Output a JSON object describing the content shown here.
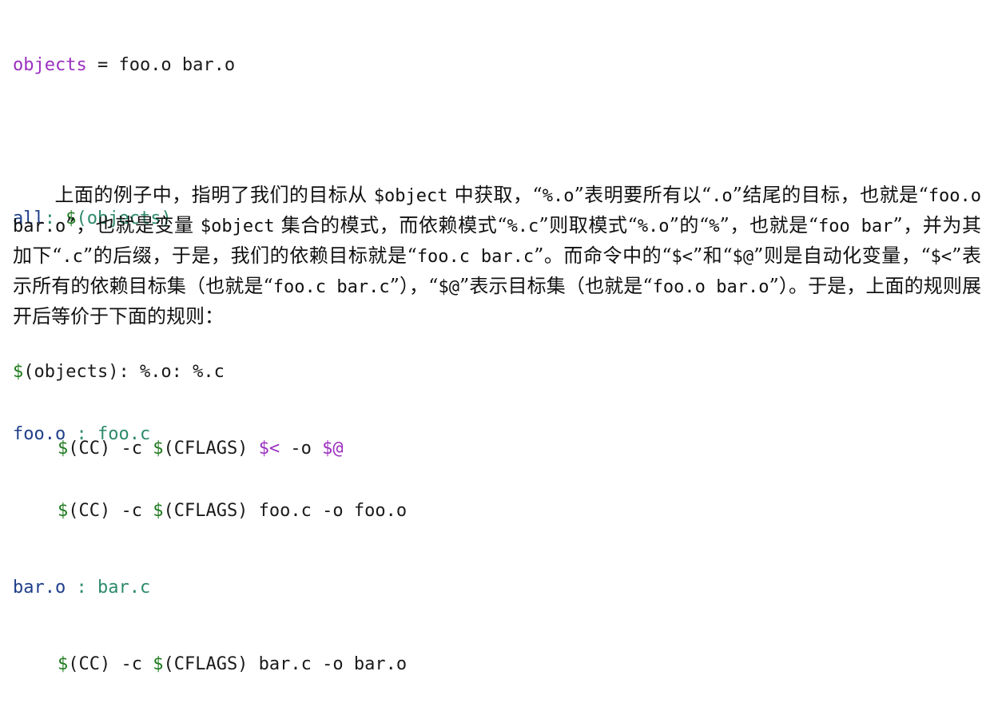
{
  "code1": {
    "line1": {
      "var": "objects",
      "rest": " = foo.o bar.o"
    },
    "line2": {
      "target": "all",
      "colon": ": ",
      "dollar": "$",
      "dep": "(objects)"
    },
    "line3": {
      "dollar": "$",
      "rest": "(objects): %.o: %.c"
    },
    "line4": {
      "d1": "$",
      "cc": "(CC) -c ",
      "d2": "$",
      "cflags": "(CFLAGS) ",
      "auto1": "$<",
      "mid": " -o ",
      "auto2": "$@"
    }
  },
  "paragraph": {
    "s1": "上面的例子中，指明了我们的目标从 ",
    "m1": "$object",
    "s2": " 中获取，“",
    "m2": "%.o",
    "s3": "”表明要所有以“",
    "m3": ".o",
    "s4": "”结尾的目标，也就是“",
    "m4": "foo.o bar.o",
    "s5": "”，也就是变量 ",
    "m5": "$object",
    "s6": " 集合的模式，而依赖模式“",
    "m6": "%.c",
    "s7": "”则取模式“",
    "m7": "%.o",
    "s8": "”的“",
    "m8": "%",
    "s9": "”，也就是“",
    "m9": "foo bar",
    "s10": "”，并为其加下“",
    "m10": ".c",
    "s11": "”的后缀，于是，我们的依赖目标就是“",
    "m11": "foo.c bar.c",
    "s12": "”。而命令中的“",
    "m12": "$<",
    "s13": "”和“",
    "m13": "$@",
    "s14": "”则是自动化变量，“",
    "m14": "$<",
    "s15": "”表示所有的依赖目标集（也就是“",
    "m15": "foo.c bar.c",
    "s16": "”），“",
    "m16": "$@",
    "s17": "”表示目标集（也就是“",
    "m17": "foo.o bar.o",
    "s18": "”）。于是，上面的规则展开后等价于下面的规则："
  },
  "code2": {
    "line1": {
      "target": "foo.o",
      "sep": " : ",
      "dep": "foo.c"
    },
    "line2": {
      "d1": "$",
      "cc": "(CC) -c ",
      "d2": "$",
      "rest": "(CFLAGS) foo.c -o foo.o"
    },
    "line3": {
      "target": "bar.o",
      "sep": " : ",
      "dep": "bar.c"
    },
    "line4": {
      "d1": "$",
      "cc": "(CC) -c ",
      "d2": "$",
      "rest": "(CFLAGS) bar.c -o bar.o"
    }
  },
  "colors": {
    "purple": "#9b30c0",
    "navy": "#1f3f8a",
    "green": "#1f7a1f",
    "teal": "#2e8b6a"
  }
}
